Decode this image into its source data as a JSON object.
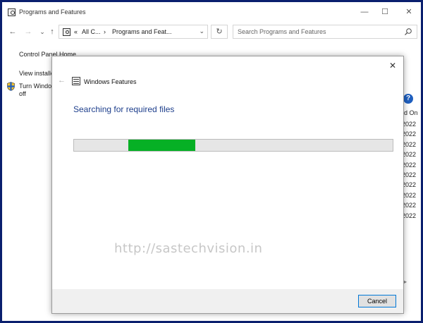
{
  "window": {
    "title": "Programs and Features",
    "minimize": "—",
    "maximize": "☐",
    "close": "✕"
  },
  "nav": {
    "back": "←",
    "forward": "→",
    "recent": "⌄",
    "up": "↑",
    "refresh": "↻"
  },
  "address": {
    "overflow": "«",
    "crumb1": "All C...",
    "separator": "›",
    "crumb2": "Programs and Feat...",
    "dropdown": "⌄"
  },
  "search": {
    "placeholder": "Search Programs and Features"
  },
  "left_pane": {
    "home": "Control Panel Home",
    "view_installed": "View installe",
    "turn_windows": "Turn Windo",
    "turn_windows_2": "off"
  },
  "right_pane": {
    "column_header": "ed On",
    "dates": [
      "2022",
      "2022",
      "2022",
      "2022",
      "2022",
      "2022",
      "2022",
      "2022",
      "2022",
      "2022"
    ],
    "help": "?"
  },
  "dialog": {
    "title": "Windows Features",
    "heading": "Searching for required files",
    "close": "✕",
    "back": "←",
    "progress_start": 0.17,
    "progress_end": 0.38,
    "watermark": "http://sastechvision.in",
    "cancel": "Cancel"
  },
  "colors": {
    "frame": "#0a1f6e",
    "progress": "#06b025",
    "heading": "#1e3f8c"
  }
}
